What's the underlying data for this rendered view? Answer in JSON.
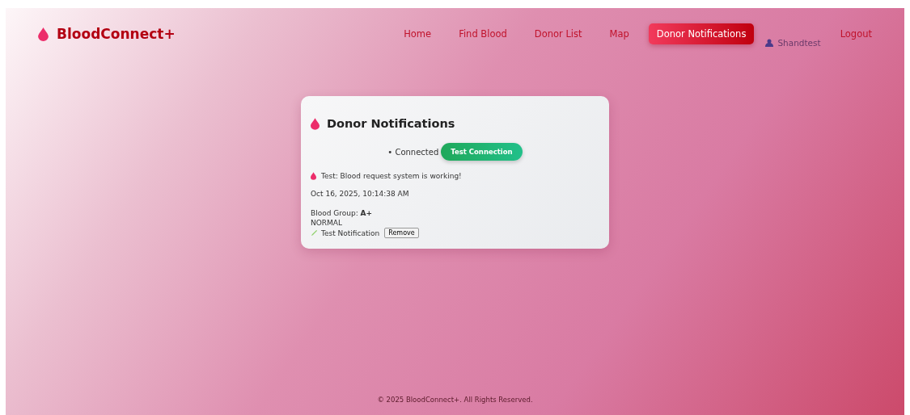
{
  "brand": {
    "name": "BloodConnect+"
  },
  "nav": {
    "items": [
      {
        "label": "Home",
        "selected": false
      },
      {
        "label": "Find Blood",
        "selected": false
      },
      {
        "label": "Donor List",
        "selected": false
      },
      {
        "label": "Map",
        "selected": false
      },
      {
        "label": "Donor Notifications",
        "selected": true
      }
    ],
    "user": "Shandtest",
    "logout": "Logout"
  },
  "card": {
    "title": "Donor Notifications",
    "status": "• Connected",
    "test_button": "Test Connection",
    "notification": {
      "message": "Test: Blood request system is working!",
      "time": "Oct 16, 2025, 10:14:38 AM",
      "blood_group": "Blood Group: **A+**",
      "urgency": "NORMAL",
      "type_label": "Test Notification",
      "remove_button": "Remove"
    }
  },
  "footer": "© 2025 BloodConnect+. All Rights Reserved."
}
